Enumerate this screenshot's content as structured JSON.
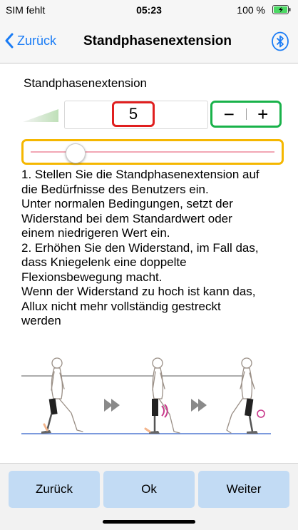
{
  "status": {
    "carrier": "SIM fehlt",
    "time": "05:23",
    "battery": "100 %"
  },
  "nav": {
    "back_label": "Zurück",
    "title": "Standphasenextension"
  },
  "section": {
    "label": "Standphasenextension"
  },
  "value": "5",
  "stepper": {
    "minus": "−",
    "plus": "+"
  },
  "slider": {
    "level_fraction": 0.18
  },
  "instructions": [
    "1. Stellen Sie die Standphasenextension auf",
    "die Bedürfnisse des Benutzers ein.",
    "Unter normalen Bedingungen, setzt der",
    "Widerstand bei dem Standardwert oder",
    "einem niedrigeren Wert ein.",
    "2. Erhöhen Sie den Widerstand, im Fall das,",
    "dass Kniegelenk eine doppelte",
    "Flexionsbewegung macht.",
    "Wenn der Widerstand zu hoch ist kann das,",
    "Allux nicht mehr vollständig gestreckt",
    "werden"
  ],
  "buttons": {
    "back": "Zurück",
    "ok": "Ok",
    "next": "Weiter"
  },
  "colors": {
    "accent_blue": "#1a7cf5",
    "value_highlight": "#e01f1f",
    "stepper_highlight": "#19b24a",
    "slider_highlight": "#f5b700",
    "button_bg": "#c2dbf4",
    "battery_green": "#4cd964"
  }
}
